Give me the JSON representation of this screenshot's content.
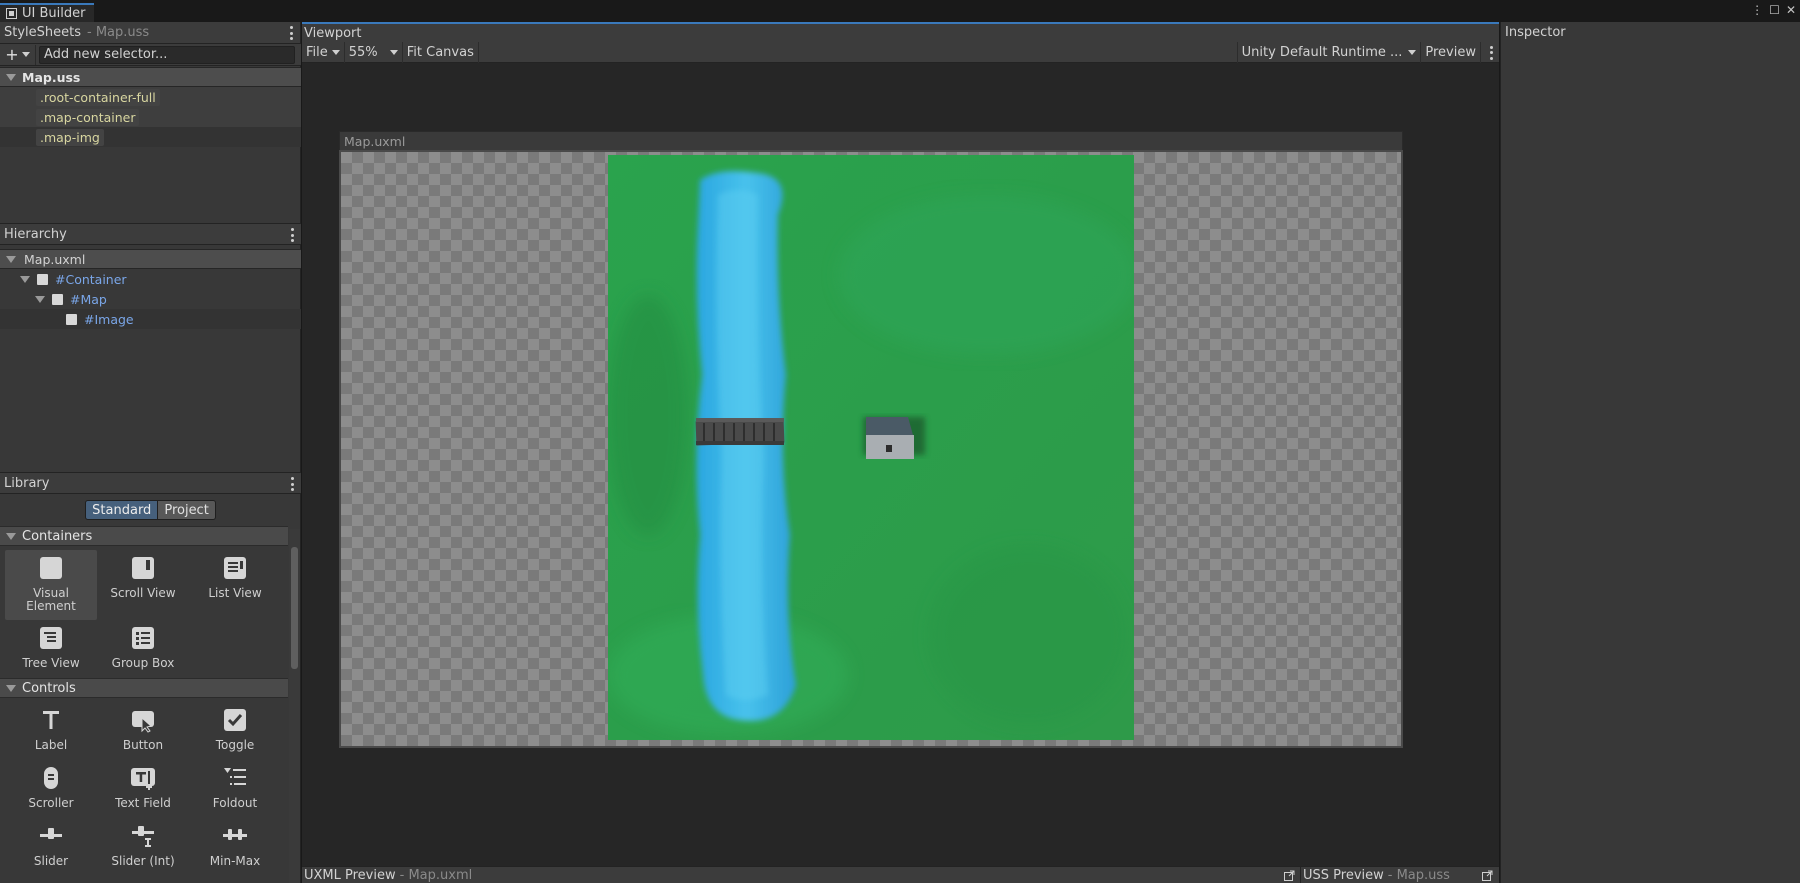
{
  "window": {
    "tab_title": "UI Builder"
  },
  "stylesheets": {
    "title": "StyleSheets",
    "file": "Map.uss",
    "add_placeholder": "Add new selector...",
    "sheet_name": "Map.uss",
    "selectors": [
      ".root-container-full",
      ".map-container",
      ".map-img"
    ]
  },
  "hierarchy": {
    "title": "Hierarchy",
    "root": "Map.uxml",
    "items": [
      "#Container",
      "#Map",
      "#Image"
    ]
  },
  "library": {
    "title": "Library",
    "tabs": [
      "Standard",
      "Project"
    ],
    "sections": {
      "containers": "Containers",
      "controls": "Controls"
    },
    "containers": [
      {
        "label": "Visual Element",
        "icon": "visual-element-icon"
      },
      {
        "label": "Scroll View",
        "icon": "scroll-view-icon"
      },
      {
        "label": "List View",
        "icon": "list-view-icon"
      },
      {
        "label": "Tree View",
        "icon": "tree-view-icon"
      },
      {
        "label": "Group Box",
        "icon": "group-box-icon"
      }
    ],
    "controls": [
      {
        "label": "Label",
        "icon": "label-icon"
      },
      {
        "label": "Button",
        "icon": "button-icon"
      },
      {
        "label": "Toggle",
        "icon": "toggle-icon"
      },
      {
        "label": "Scroller",
        "icon": "scroller-icon"
      },
      {
        "label": "Text Field",
        "icon": "text-field-icon"
      },
      {
        "label": "Foldout",
        "icon": "foldout-icon"
      },
      {
        "label": "Slider",
        "icon": "slider-icon"
      },
      {
        "label": "Slider (Int)",
        "icon": "slider-int-icon"
      },
      {
        "label": "Min-Max",
        "icon": "min-max-icon"
      }
    ]
  },
  "viewport": {
    "title": "Viewport",
    "file_menu": "File",
    "zoom": "55%",
    "fit_canvas": "Fit Canvas",
    "theme": "Unity Default Runtime ...",
    "preview": "Preview",
    "canvas_title": "Map.uxml"
  },
  "bottom": {
    "uxml_label": "UXML Preview",
    "uxml_file": "Map.uxml",
    "uss_label": "USS Preview",
    "uss_file": "Map.uss"
  },
  "inspector": {
    "title": "Inspector"
  },
  "colors": {
    "accent": "#3a79bb",
    "selector_text": "#d8d6a0",
    "hierarchy_text": "#7aa6e8",
    "grass": "#2f9e4a",
    "river": "#3fb6e6"
  }
}
